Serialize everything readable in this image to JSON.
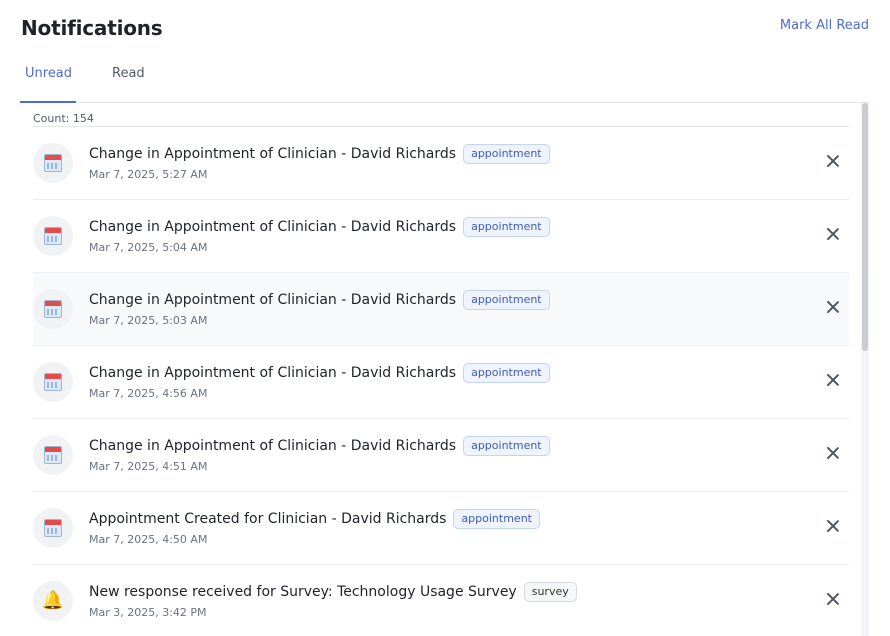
{
  "header": {
    "title": "Notifications",
    "mark_all_label": "Mark All Read"
  },
  "tabs": [
    {
      "label": "Unread",
      "active": true
    },
    {
      "label": "Read",
      "active": false
    }
  ],
  "list": {
    "count_text": "Count: 154",
    "items": [
      {
        "title": "Change in Appointment of Clinician - David Richards",
        "tag": "appointment",
        "time": "Mar 7, 2025, 5:27 AM",
        "icon": "calendar-icon"
      },
      {
        "title": "Change in Appointment of Clinician - David Richards",
        "tag": "appointment",
        "time": "Mar 7, 2025, 5:04 AM",
        "icon": "calendar-icon"
      },
      {
        "title": "Change in Appointment of Clinician - David Richards",
        "tag": "appointment",
        "time": "Mar 7, 2025, 5:03 AM",
        "icon": "calendar-icon"
      },
      {
        "title": "Change in Appointment of Clinician - David Richards",
        "tag": "appointment",
        "time": "Mar 7, 2025, 4:56 AM",
        "icon": "calendar-icon"
      },
      {
        "title": "Change in Appointment of Clinician - David Richards",
        "tag": "appointment",
        "time": "Mar 7, 2025, 4:51 AM",
        "icon": "calendar-icon"
      },
      {
        "title": "Appointment Created for Clinician - David Richards",
        "tag": "appointment",
        "time": "Mar 7, 2025, 4:50 AM",
        "icon": "calendar-icon"
      },
      {
        "title": "New response received for Survey: Technology Usage Survey",
        "tag": "survey",
        "time": "Mar 3, 2025, 3:42 PM",
        "icon": "bell-icon"
      }
    ]
  },
  "colors": {
    "accent": "#4e6bd1",
    "badge_appointment": "#3d5bbf",
    "bell": "#f0b400",
    "calendar_top": "#e64b4b"
  }
}
